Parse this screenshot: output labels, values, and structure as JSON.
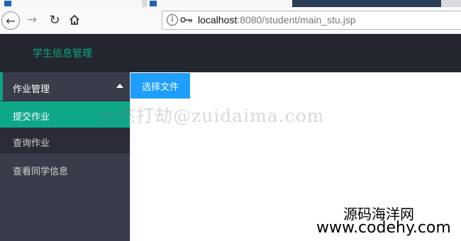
{
  "browser": {
    "url_info_icon": "i",
    "url_host": "localhost",
    "url_rest": ":8080/student/main_stu.jsp"
  },
  "header": {
    "title": "学生信息管理"
  },
  "sidebar": {
    "group": {
      "label": "作业管理",
      "expanded": true
    },
    "items": [
      {
        "label": "提交作业",
        "active": true
      },
      {
        "label": "查询作业",
        "active": false
      },
      {
        "label": "查看同学信息",
        "active": false
      }
    ]
  },
  "main": {
    "upload_label": "选择文件"
  },
  "watermarks": {
    "overlay": "大杰打劫@zuidaima.com",
    "site_cn": "源码海洋网",
    "site_url": "www.codehy.com"
  },
  "colors": {
    "accent": "#0ea889",
    "button": "#1e9fff",
    "header_bg": "#23262e",
    "sidebar_bg": "#393d49"
  }
}
